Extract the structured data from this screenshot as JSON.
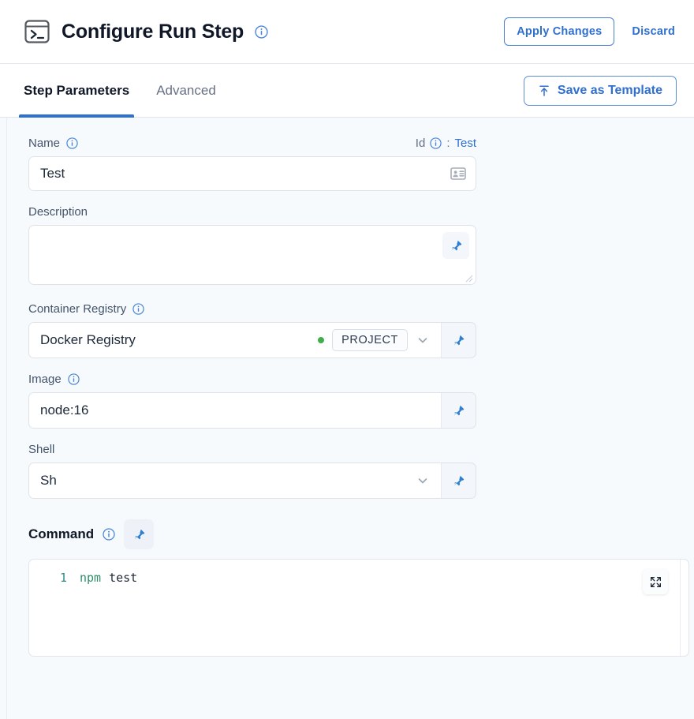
{
  "header": {
    "icon": "terminal-icon",
    "title": "Configure Run Step",
    "title_info_icon": "info-icon",
    "apply_label": "Apply Changes",
    "discard_label": "Discard"
  },
  "tabbar": {
    "tabs": [
      {
        "label": "Step Parameters",
        "active": true
      },
      {
        "label": "Advanced",
        "active": false
      }
    ],
    "save_template_label": "Save as Template",
    "save_template_icon": "upload-icon"
  },
  "form": {
    "name": {
      "label": "Name",
      "info_icon": "info-icon",
      "id_label": "Id",
      "id_separator": ":",
      "id_value": "Test",
      "value": "Test",
      "trailing_icon": "contact-card-icon"
    },
    "description": {
      "label": "Description",
      "value": "",
      "placeholder": "",
      "pin_icon": "pin-icon",
      "resize_icon": "resize-grip-icon"
    },
    "container_registry": {
      "label": "Container Registry",
      "info_icon": "info-icon",
      "value": "Docker Registry",
      "status_dot": "green-status-dot",
      "badge": "PROJECT",
      "chevron_icon": "chevron-down-icon",
      "pin_icon": "pin-icon"
    },
    "image": {
      "label": "Image",
      "info_icon": "info-icon",
      "value": "node:16",
      "pin_icon": "pin-icon"
    },
    "shell": {
      "label": "Shell",
      "value": "Sh",
      "chevron_icon": "chevron-down-icon",
      "pin_icon": "pin-icon"
    },
    "command": {
      "label": "Command",
      "info_icon": "info-icon",
      "pin_icon": "pin-icon",
      "expand_icon": "expand-icon",
      "line_number": "1",
      "code_token": "npm",
      "code_arg": "test"
    }
  },
  "colors": {
    "accent": "#2f6fd0",
    "page_bg": "#f6fafd",
    "status_green": "#3fae4b",
    "code_keyword": "#2f8f6b",
    "gutter": "#2b8a84"
  }
}
